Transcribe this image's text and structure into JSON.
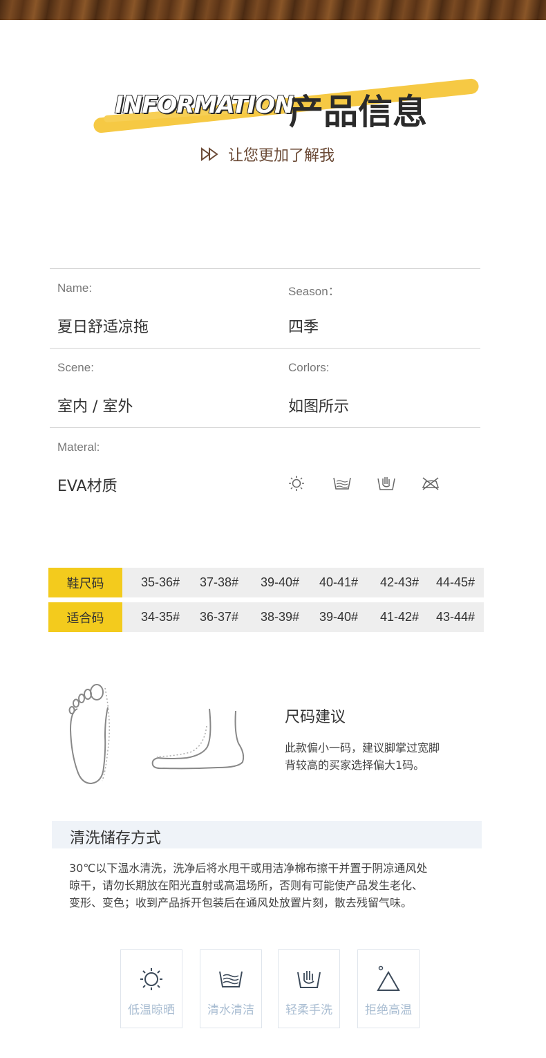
{
  "header": {
    "title_en": "INFORMATION",
    "title_cn": "产品信息",
    "subtitle": "让您更加了解我"
  },
  "info": {
    "name_label": "Name:",
    "name_value": "夏日舒适凉拖",
    "season_label": "Season：",
    "season_value": "四季",
    "scene_label": "Scene:",
    "scene_value": "室内 / 室外",
    "colors_label": "Corlors:",
    "colors_value": "如图所示",
    "material_label": "Materal:",
    "material_value": "EVA材质",
    "care_icons": [
      "sun-icon",
      "water-basin-icon",
      "hand-wash-icon",
      "no-iron-icon"
    ]
  },
  "size_table": {
    "shoe_size_label": "鞋尺码",
    "fit_size_label": "适合码",
    "shoe_sizes": [
      "35-36#",
      "37-38#",
      "39-40#",
      "40-41#",
      "42-43#",
      "44-45#"
    ],
    "fit_sizes": [
      "34-35#",
      "36-37#",
      "38-39#",
      "39-40#",
      "41-42#",
      "43-44#"
    ]
  },
  "advice": {
    "title": "尺码建议",
    "line1": "此款偏小一码，建议脚掌过宽脚",
    "line2": "背较高的买家选择偏大1码。"
  },
  "cleaning": {
    "title": "清洗储存方式",
    "line1": "30℃以下温水清洗，洗净后将水甩干或用洁净棉布擦干并置于阴凉通风处",
    "line2": "晾干，请勿长期放在阳光直射或高温场所，否则有可能使产品发生老化、",
    "line3": "变形、变色；收到产品拆开包装后在通风处放置片刻，散去残留气味。"
  },
  "care_cards": [
    {
      "icon": "sun-icon",
      "label": "低温晾晒"
    },
    {
      "icon": "water-basin-icon",
      "label": "清水清洁"
    },
    {
      "icon": "hand-wash-icon",
      "label": "轻柔手洗"
    },
    {
      "icon": "no-high-temp-icon",
      "label": "拒绝高温"
    }
  ],
  "colors": {
    "accent_yellow": "#f3cb1d",
    "subtitle_brown": "#6b4a36",
    "care_blue": "#a9bdd2"
  }
}
